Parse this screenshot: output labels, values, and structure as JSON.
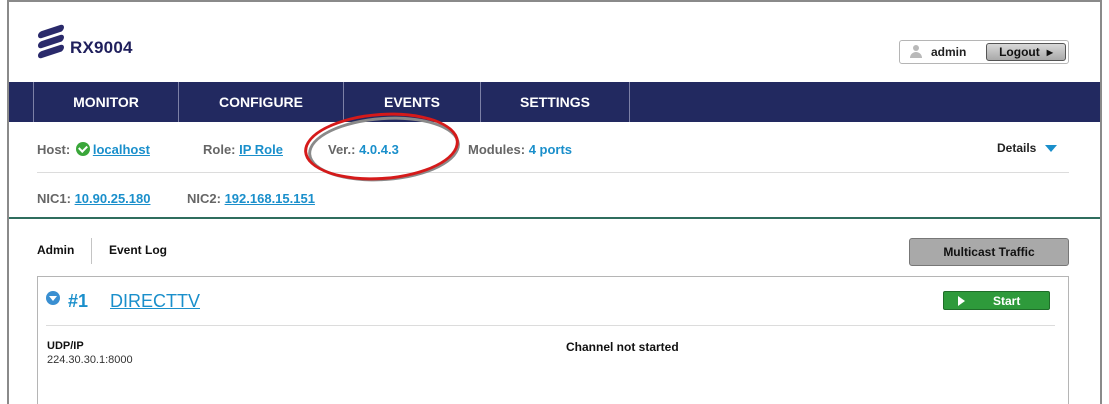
{
  "app": {
    "logo_text": "RX9004"
  },
  "user": {
    "name": "admin",
    "logout_label": "Logout"
  },
  "nav": {
    "items": [
      "MONITOR",
      "CONFIGURE",
      "EVENTS",
      "SETTINGS"
    ]
  },
  "info": {
    "host_label": "Host:",
    "host_value": "localhost",
    "role_label": "Role:",
    "role_value": "IP Role",
    "ver_label": "Ver.:",
    "ver_value": "4.0.4.3",
    "modules_label": "Modules:",
    "modules_value": "4 ports",
    "details_label": "Details",
    "nic1_label": "NIC1:",
    "nic1_value": "10.90.25.180",
    "nic2_label": "NIC2:",
    "nic2_value": "192.168.15.151"
  },
  "tabs": {
    "admin": "Admin",
    "event_log": "Event Log",
    "multicast_button": "Multicast Traffic"
  },
  "channel": {
    "number": "#1",
    "name": "DIRECTTV",
    "start_label": "Start",
    "protocol_label": "UDP/IP",
    "address": "224.30.30.1:8000",
    "status": "Channel not started"
  },
  "colors": {
    "nav_bg": "#222960",
    "link": "#1a8fcb",
    "start_green": "#2e9a3b",
    "annotation_red": "#d51a1a"
  }
}
